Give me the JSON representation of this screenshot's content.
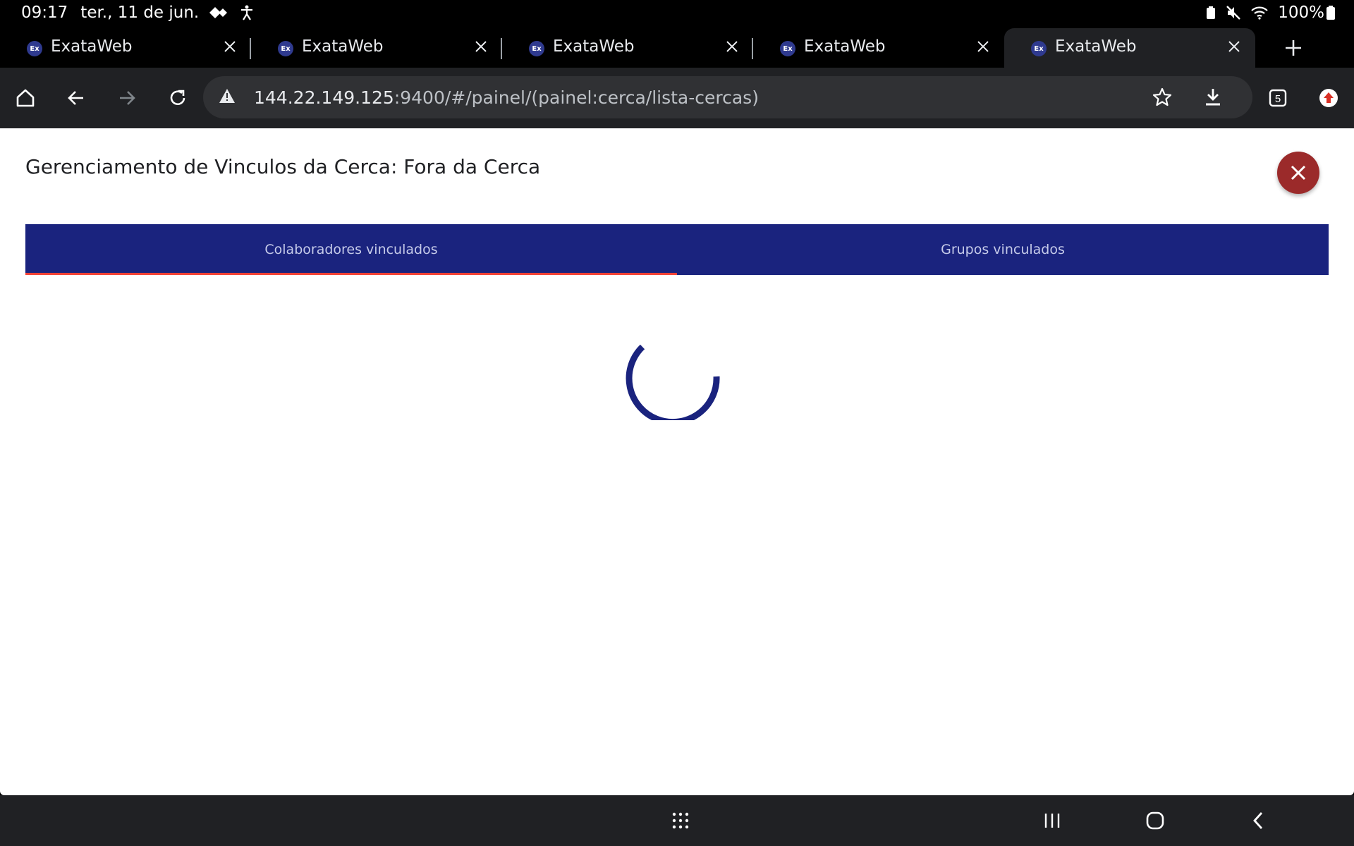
{
  "status_bar": {
    "time": "09:17",
    "date": "ter., 11 de jun.",
    "battery": "100%"
  },
  "tabs": [
    {
      "title": "ExataWeb",
      "favicon": "Ex",
      "active": false
    },
    {
      "title": "ExataWeb",
      "favicon": "Ex",
      "active": false
    },
    {
      "title": "ExataWeb",
      "favicon": "Ex",
      "active": false
    },
    {
      "title": "ExataWeb",
      "favicon": "Ex",
      "active": false
    },
    {
      "title": "ExataWeb",
      "favicon": "Ex",
      "active": true
    }
  ],
  "toolbar": {
    "url_host": "144.22.149.125",
    "url_rest": ":9400/#/painel/(painel:cerca/lista-cercas)",
    "tab_count": "5"
  },
  "modal": {
    "title": "Gerenciamento de Vinculos da Cerca: Fora da Cerca",
    "tabs": [
      {
        "label": "Colaboradores vinculados",
        "active": true
      },
      {
        "label": "Grupos vinculados",
        "active": false
      }
    ]
  },
  "colors": {
    "tab_bar": "#1a237e",
    "active_indicator": "#f44336",
    "close_button": "#9b2a2a",
    "spinner": "#1a237e"
  }
}
